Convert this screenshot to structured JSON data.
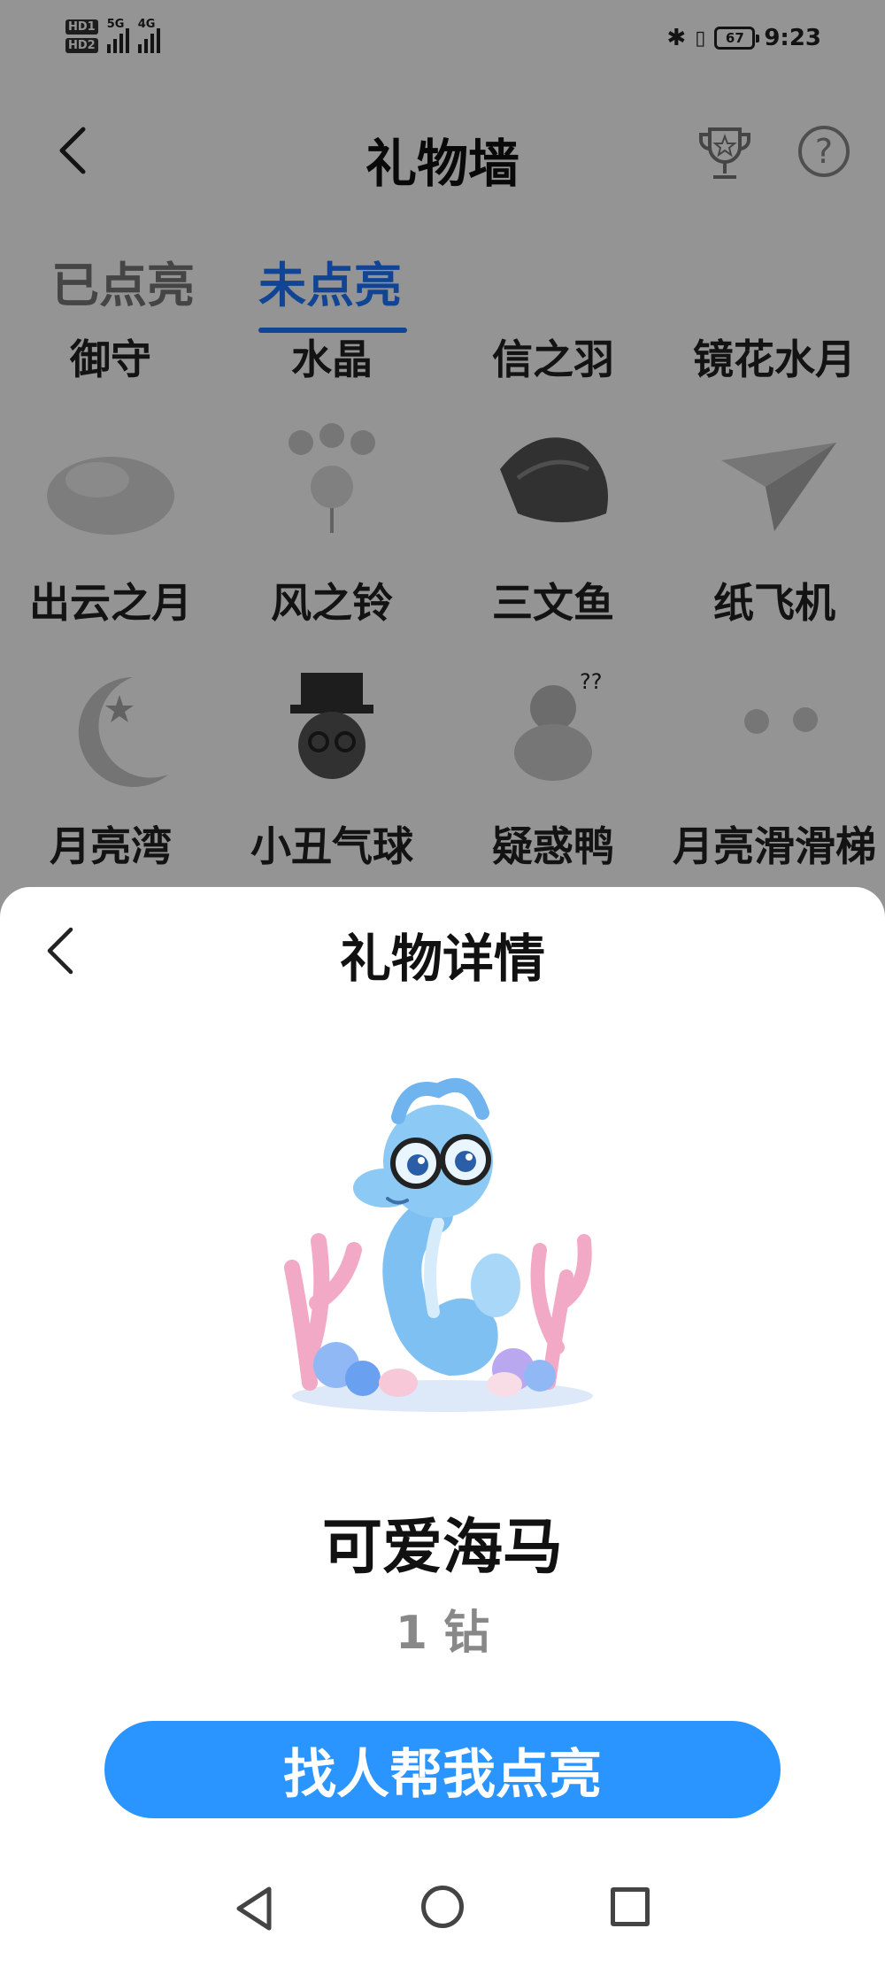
{
  "status_bar": {
    "hd1": "HD1",
    "hd2": "HD2",
    "net1": "5G",
    "net2": "4G",
    "battery": "67",
    "time": "9:23"
  },
  "header": {
    "title": "礼物墙",
    "back_icon": "back-chevron-icon",
    "trophy_icon": "trophy-icon",
    "help_icon": "help-question-icon"
  },
  "tabs": [
    {
      "label": "已点亮",
      "active": false
    },
    {
      "label": "未点亮",
      "active": true
    }
  ],
  "gift_grid": {
    "row0": [
      "御守",
      "水晶",
      "信之羽",
      "镜花水月"
    ],
    "row1": [
      "出云之月",
      "风之铃",
      "三文鱼",
      "纸飞机"
    ],
    "row2": [
      "月亮湾",
      "小丑气球",
      "疑惑鸭",
      "月亮滑滑梯"
    ]
  },
  "sheet": {
    "title": "礼物详情",
    "gift_name": "可爱海马",
    "price": "1 钻",
    "cta": "找人帮我点亮"
  },
  "colors": {
    "accent": "#1e78ff",
    "button": "#2b95ff",
    "overlay": "rgba(0,0,0,0.42)"
  }
}
